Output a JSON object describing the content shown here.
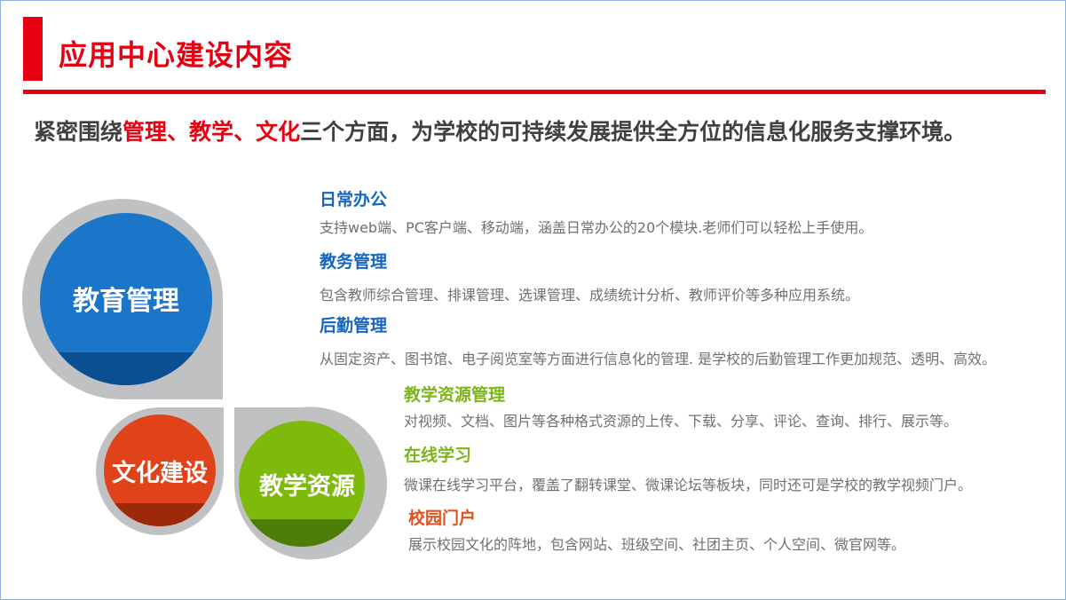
{
  "header": {
    "title": "应用中心建设内容"
  },
  "lead": {
    "pre": "紧密围绕",
    "hl1": "管理",
    "sep1": "、",
    "hl2": "教学",
    "sep2": "、",
    "hl3": "文化",
    "post": "三个方面，为学校的可持续发展提供全方位的信息化服务支撑环境。"
  },
  "circles": {
    "edu": "教育管理",
    "culture": "文化建设",
    "resource": "教学资源"
  },
  "colors": {
    "accent_red": "#e60012",
    "edu_blue": "#1565c0",
    "culture_orange": "#e2501f",
    "resource_green": "#7cb518"
  },
  "items": [
    {
      "title": "日常办公",
      "desc": "支持web端、PC客户端、移动端，涵盖日常办公的20个模块.老师们可以轻松上手使用。"
    },
    {
      "title": "教务管理",
      "desc": "包含教师综合管理、排课管理、选课管理、成绩统计分析、教师评价等多种应用系统。"
    },
    {
      "title": "后勤管理",
      "desc": "从固定资产、图书馆、电子阅览室等方面进行信息化的管理. 是学校的后勤管理工作更加规范、透明、高效。"
    },
    {
      "title": "教学资源管理",
      "desc": "对视频、文档、图片等各种格式资源的上传、下载、分享、评论、查询、排行、展示等。"
    },
    {
      "title": "在线学习",
      "desc": "微课在线学习平台，覆盖了翻转课堂、微课论坛等板块，同时还可是学校的教学视频门户。"
    },
    {
      "title": "校园门户",
      "desc": "展示校园文化的阵地，包含网站、班级空间、社团主页、个人空间、微官网等。"
    }
  ]
}
